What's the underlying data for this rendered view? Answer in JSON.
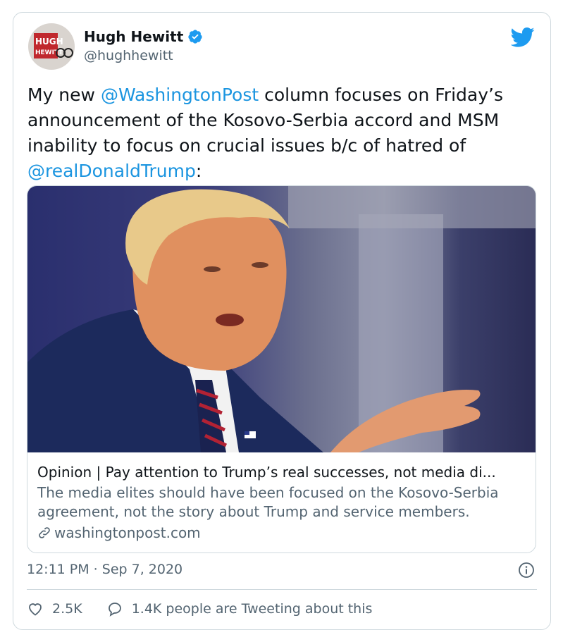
{
  "author": {
    "name": "Hugh Hewitt",
    "handle": "@hughhewitt",
    "avatar_text_top": "HUGH",
    "avatar_text_bottom": "HEWITT"
  },
  "tweet": {
    "text_prefix": "My new ",
    "mention_1": "@WashingtonPost",
    "text_middle": " column focuses on Friday’s announcement of the Kosovo-Serbia accord and MSM inability to focus on crucial issues b/c of hatred of ",
    "mention_2": "@realDonaldTrump",
    "text_suffix": ":"
  },
  "link_card": {
    "title": "Opinion | Pay attention to Trump’s real successes, not media di...",
    "description": "The media elites should have been focused on the Kosovo-Serbia agreement, not the story about Trump and service members.",
    "domain": "washingtonpost.com"
  },
  "timestamp": "12:11 PM · Sep 7, 2020",
  "actions": {
    "likes": "2.5K",
    "conversation": "1.4K people are Tweeting about this"
  },
  "colors": {
    "link_blue": "#1b95e0",
    "twitter_blue": "#1d9bf0",
    "muted_text": "#536471",
    "border": "#cfd9de"
  },
  "icons": [
    "verified-badge-icon",
    "twitter-bird-icon",
    "link-icon",
    "info-icon",
    "heart-icon",
    "chat-bubble-icon"
  ]
}
